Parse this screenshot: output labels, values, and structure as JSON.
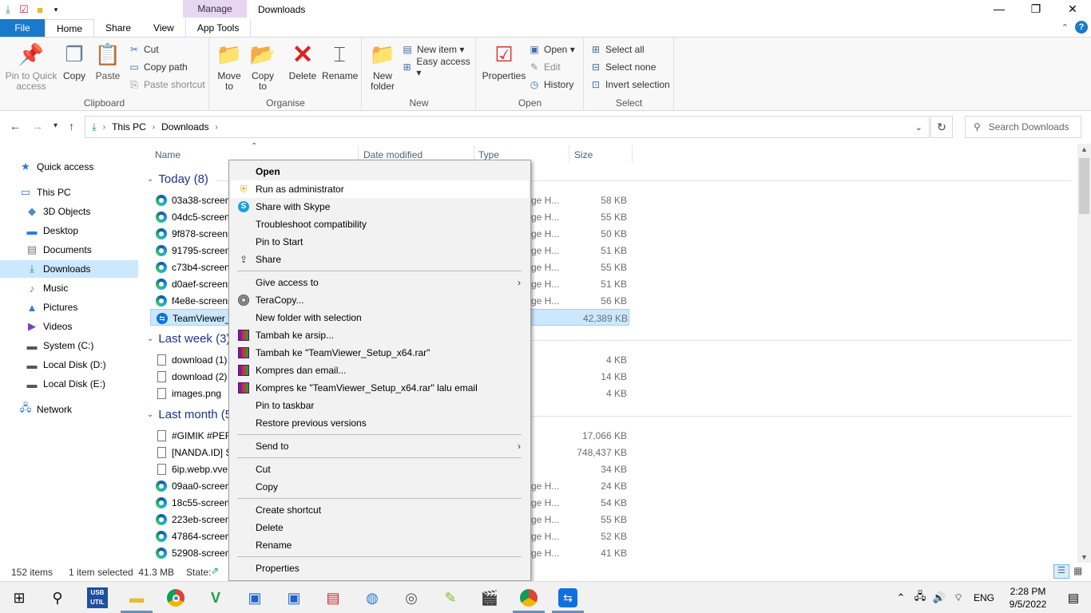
{
  "window": {
    "title": "Downloads",
    "manage_tab": "Manage",
    "controls": {
      "minimize": "—",
      "restore": "❐",
      "close": "✕"
    }
  },
  "ribbon_tabs": {
    "file": "File",
    "home": "Home",
    "share": "Share",
    "view": "View",
    "app_tools": "App Tools"
  },
  "ribbon": {
    "clipboard": {
      "label": "Clipboard",
      "pin_to_quick_access": "Pin to Quick access",
      "copy": "Copy",
      "paste": "Paste",
      "cut": "Cut",
      "copy_path": "Copy path",
      "paste_shortcut": "Paste shortcut"
    },
    "organise": {
      "label": "Organise",
      "move_to": "Move to",
      "copy_to": "Copy to",
      "delete": "Delete",
      "rename": "Rename"
    },
    "new": {
      "label": "New",
      "new_folder": "New folder",
      "new_item": "New item ▾",
      "easy_access": "Easy access ▾"
    },
    "open": {
      "label": "Open",
      "properties": "Properties",
      "open": "Open ▾",
      "edit": "Edit",
      "history": "History"
    },
    "select": {
      "label": "Select",
      "select_all": "Select all",
      "select_none": "Select none",
      "invert_selection": "Invert selection"
    }
  },
  "address": {
    "path": [
      "This PC",
      "Downloads"
    ],
    "search_placeholder": "Search Downloads"
  },
  "nav": {
    "items": [
      {
        "label": "Quick access",
        "icon": "star-icon"
      },
      {
        "label": "This PC",
        "icon": "monitor-icon"
      },
      {
        "label": "3D Objects",
        "icon": "cube-icon"
      },
      {
        "label": "Desktop",
        "icon": "desktop-icon"
      },
      {
        "label": "Documents",
        "icon": "documents-icon"
      },
      {
        "label": "Downloads",
        "icon": "download-icon"
      },
      {
        "label": "Music",
        "icon": "music-icon"
      },
      {
        "label": "Pictures",
        "icon": "pictures-icon"
      },
      {
        "label": "Videos",
        "icon": "videos-icon"
      },
      {
        "label": "System (C:)",
        "icon": "drive-icon"
      },
      {
        "label": "Local Disk (D:)",
        "icon": "drive-icon"
      },
      {
        "label": "Local Disk (E:)",
        "icon": "drive-icon"
      },
      {
        "label": "Network",
        "icon": "network-icon"
      }
    ]
  },
  "columns": {
    "name": "Name",
    "date": "Date modified",
    "type": "Type",
    "size": "Size"
  },
  "groups": {
    "today": "Today (8)",
    "last_week": "Last week (3)",
    "last_month": "Last month (5"
  },
  "files_today": [
    {
      "name": "03a38-screen",
      "type": "ge H...",
      "size": "58 KB"
    },
    {
      "name": "04dc5-screen",
      "type": "ge H...",
      "size": "55 KB"
    },
    {
      "name": "9f878-screens",
      "type": "ge H...",
      "size": "50 KB"
    },
    {
      "name": "91795-screen",
      "type": "ge H...",
      "size": "51 KB"
    },
    {
      "name": "c73b4-screen",
      "type": "ge H...",
      "size": "55 KB"
    },
    {
      "name": "d0aef-screens",
      "type": "ge H...",
      "size": "51 KB"
    },
    {
      "name": "f4e8e-screens",
      "type": "ge H...",
      "size": "56 KB"
    },
    {
      "name": "TeamViewer_S",
      "type": "",
      "size": "42,389 KB"
    }
  ],
  "files_last_week": [
    {
      "name": "download (1)",
      "size": "4 KB"
    },
    {
      "name": "download (2)",
      "size": "14 KB"
    },
    {
      "name": "images.png",
      "size": "4 KB"
    }
  ],
  "files_last_month": [
    {
      "name": "#GIMIK #PER",
      "type": "",
      "size": "17,066 KB"
    },
    {
      "name": "[NANDA.ID] S",
      "type": "",
      "size": "748,437 KB"
    },
    {
      "name": "6ip.webp.vve",
      "type": "",
      "size": "34 KB"
    },
    {
      "name": "09aa0-screen",
      "type": "ge H...",
      "size": "24 KB"
    },
    {
      "name": "18c55-screen",
      "type": "ge H...",
      "size": "54 KB"
    },
    {
      "name": "223eb-screen",
      "type": "ge H...",
      "size": "55 KB"
    },
    {
      "name": "47864-screen",
      "type": "ge H...",
      "size": "52 KB"
    },
    {
      "name": "52908-screen",
      "type": "ge H...",
      "size": "41 KB"
    }
  ],
  "context_menu": {
    "open": "Open",
    "run_as_admin": "Run as administrator",
    "share_skype": "Share with Skype",
    "troubleshoot": "Troubleshoot compatibility",
    "pin_start": "Pin to Start",
    "share": "Share",
    "give_access": "Give access to",
    "teracopy": "TeraCopy...",
    "new_folder_sel": "New folder with selection",
    "tambah_arsip": "Tambah ke arsip...",
    "tambah_ke": "Tambah ke \"TeamViewer_Setup_x64.rar\"",
    "kompres_email": "Kompres dan email...",
    "kompres_ke": "Kompres ke \"TeamViewer_Setup_x64.rar\" lalu email",
    "pin_taskbar": "Pin to taskbar",
    "restore_prev": "Restore previous versions",
    "send_to": "Send to",
    "cut": "Cut",
    "copy": "Copy",
    "create_shortcut": "Create shortcut",
    "delete": "Delete",
    "rename": "Rename",
    "properties": "Properties"
  },
  "status": {
    "items": "152 items",
    "selected": "1 item selected  41.3 MB",
    "state": "State:"
  },
  "taskbar": {
    "lang": "ENG",
    "time": "2:28 PM",
    "date": "9/5/2022",
    "usb_label": "USB UTIL"
  }
}
